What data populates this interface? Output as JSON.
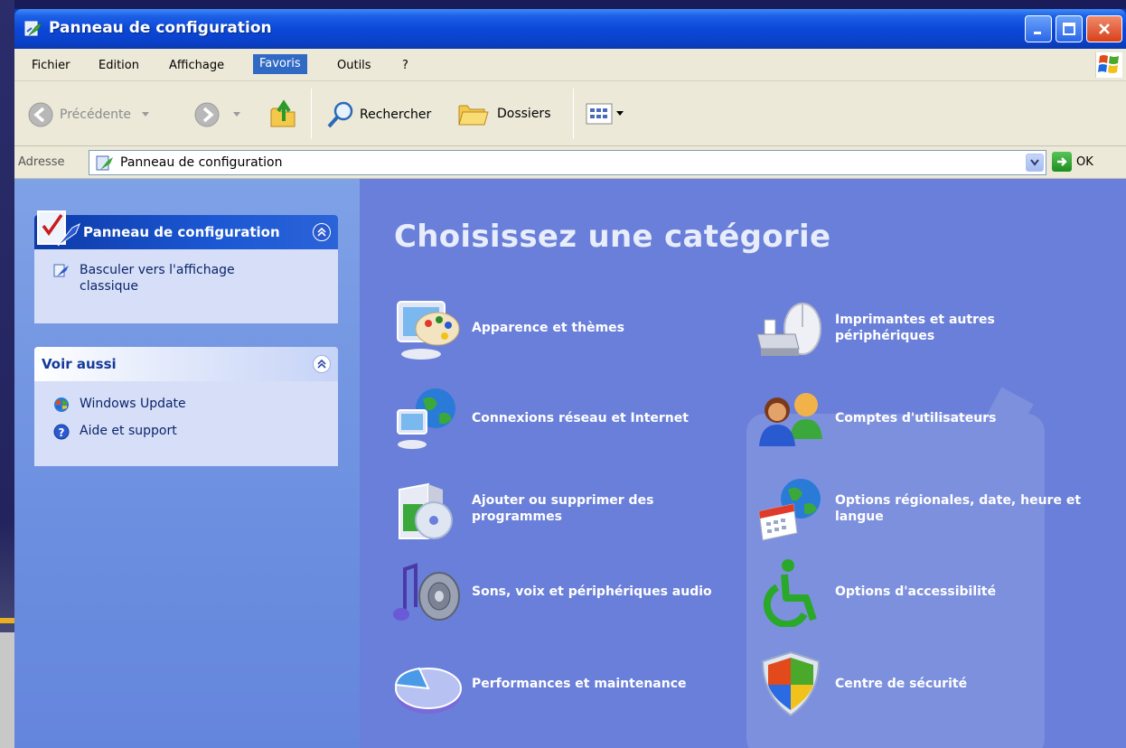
{
  "window": {
    "title": "Panneau de configuration"
  },
  "menu": {
    "items": [
      {
        "label": "Fichier",
        "active": false
      },
      {
        "label": "Edition",
        "active": false
      },
      {
        "label": "Affichage",
        "active": false
      },
      {
        "label": "Favoris",
        "active": true
      },
      {
        "label": "Outils",
        "active": false
      },
      {
        "label": "?",
        "active": false
      }
    ]
  },
  "toolbar": {
    "back_label": "Précédente",
    "search_label": "Rechercher",
    "folders_label": "Dossiers"
  },
  "address": {
    "label": "Adresse",
    "value": "Panneau de configuration",
    "go_label": "OK"
  },
  "sidebar": {
    "panel1": {
      "title": "Panneau de configuration",
      "links": [
        {
          "label": "Basculer vers l'affichage classique",
          "icon": "classic-view-icon"
        }
      ]
    },
    "panel2": {
      "title": "Voir aussi",
      "links": [
        {
          "label": "Windows Update",
          "icon": "windows-update-icon"
        },
        {
          "label": "Aide et support",
          "icon": "help-icon"
        }
      ]
    }
  },
  "main": {
    "heading": "Choisissez une catégorie",
    "categories": [
      {
        "label": "Apparence et thèmes",
        "icon": "palette-monitor-icon"
      },
      {
        "label": "Imprimantes et autres périphériques",
        "icon": "printer-mouse-icon"
      },
      {
        "label": "Connexions réseau et Internet",
        "icon": "network-globe-icon"
      },
      {
        "label": "Comptes d'utilisateurs",
        "icon": "users-icon"
      },
      {
        "label": "Ajouter ou supprimer des programmes",
        "icon": "software-box-icon"
      },
      {
        "label": "Options régionales, date, heure et langue",
        "icon": "calendar-globe-icon"
      },
      {
        "label": "Sons, voix et périphériques audio",
        "icon": "speaker-note-icon"
      },
      {
        "label": "Options d'accessibilité",
        "icon": "accessibility-icon"
      },
      {
        "label": "Performances et maintenance",
        "icon": "pie-chart-icon"
      },
      {
        "label": "Centre de sécurité",
        "icon": "security-shield-icon"
      }
    ]
  },
  "colors": {
    "titlebar": "#0b48d8",
    "menu_active": "#316ac5",
    "sidebar": "#7fa1e6",
    "main_bg": "#6a7fd9",
    "category_text": "#ffffff"
  }
}
